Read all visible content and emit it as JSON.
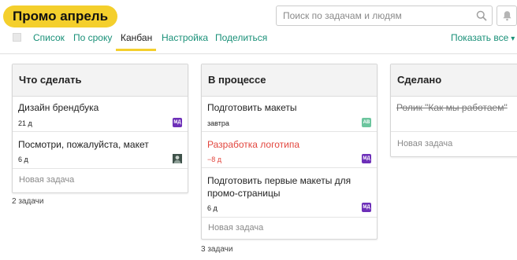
{
  "header": {
    "project_title": "Промо апрель",
    "search_placeholder": "Поиск по задачам и людям"
  },
  "tabs": [
    {
      "label": "Список",
      "active": false
    },
    {
      "label": "По сроку",
      "active": false
    },
    {
      "label": "Канбан",
      "active": true
    },
    {
      "label": "Настройка",
      "active": false
    },
    {
      "label": "Поделиться",
      "active": false
    }
  ],
  "show_all": "Показать все",
  "icons": {
    "search": "search-icon",
    "notifications": "bell-icon",
    "dropdown": "chevron-down-icon"
  },
  "colors": {
    "accent": "#199078",
    "highlight": "#f4cf2c",
    "overdue": "#e2463e",
    "avatar_md": "#6d2fb8",
    "avatar_ag": "#6cc59e"
  },
  "columns": [
    {
      "title": "Что сделать",
      "cards": [
        {
          "title": "Дизайн брендбука",
          "meta": "21 д",
          "avatar": "МД"
        },
        {
          "title": "Посмотри, пожалуйста, макет",
          "meta": "6 д",
          "avatar": "photo"
        }
      ],
      "new_task": "Новая задача",
      "count": "2 задачи"
    },
    {
      "title": "В процессе",
      "cards": [
        {
          "title": "Подготовить макеты",
          "meta": "завтра",
          "avatar": "АВ"
        },
        {
          "title": "Разработка логотипа",
          "meta": "−8 д",
          "avatar": "МД",
          "overdue": true
        },
        {
          "title": "Подготовить первые макеты для промо-страницы",
          "meta": "6 д",
          "avatar": "МД"
        }
      ],
      "new_task": "Новая задача",
      "count": "3 задачи"
    },
    {
      "title": "Сделано",
      "cards": [
        {
          "title": "Ролик \"Как мы работаем\"",
          "done": true
        }
      ],
      "new_task": "Новая задача"
    }
  ]
}
